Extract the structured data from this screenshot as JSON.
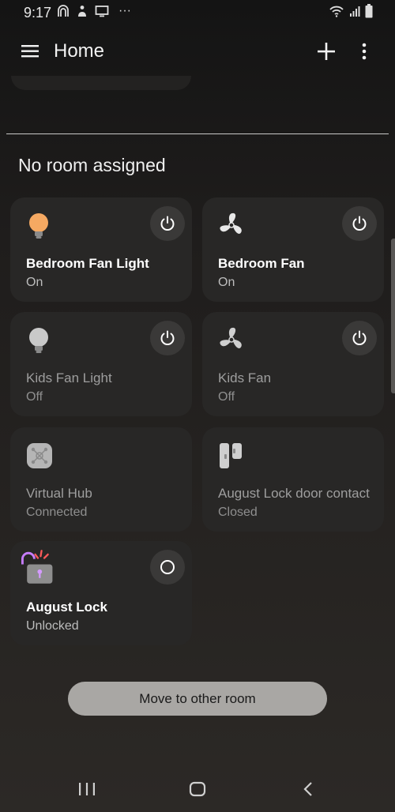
{
  "status_bar": {
    "time": "9:17",
    "more_dots": "···"
  },
  "app_bar": {
    "title": "Home"
  },
  "section": {
    "title": "No room assigned"
  },
  "devices": [
    {
      "name": "Bedroom Fan Light",
      "state": "On",
      "icon": "lightbulb-icon"
    },
    {
      "name": "Bedroom Fan",
      "state": "On",
      "icon": "fan-icon"
    },
    {
      "name": "Kids Fan Light",
      "state": "Off",
      "icon": "lightbulb-icon"
    },
    {
      "name": "Kids Fan",
      "state": "Off",
      "icon": "fan-icon"
    },
    {
      "name": "Virtual Hub",
      "state": "Connected",
      "icon": "hub-icon"
    },
    {
      "name": "August Lock door contact",
      "state": "Closed",
      "icon": "door-sensor-icon"
    },
    {
      "name": "August Lock",
      "state": "Unlocked",
      "icon": "lock-icon"
    }
  ],
  "move_button": {
    "label": "Move to other room"
  },
  "colors": {
    "bulb_on": "#f5a962",
    "card_bg": "#282726",
    "button_bg": "#a9a7a4",
    "lock_shackle": "#c77dff",
    "lock_rays": "#ff5a5a"
  }
}
